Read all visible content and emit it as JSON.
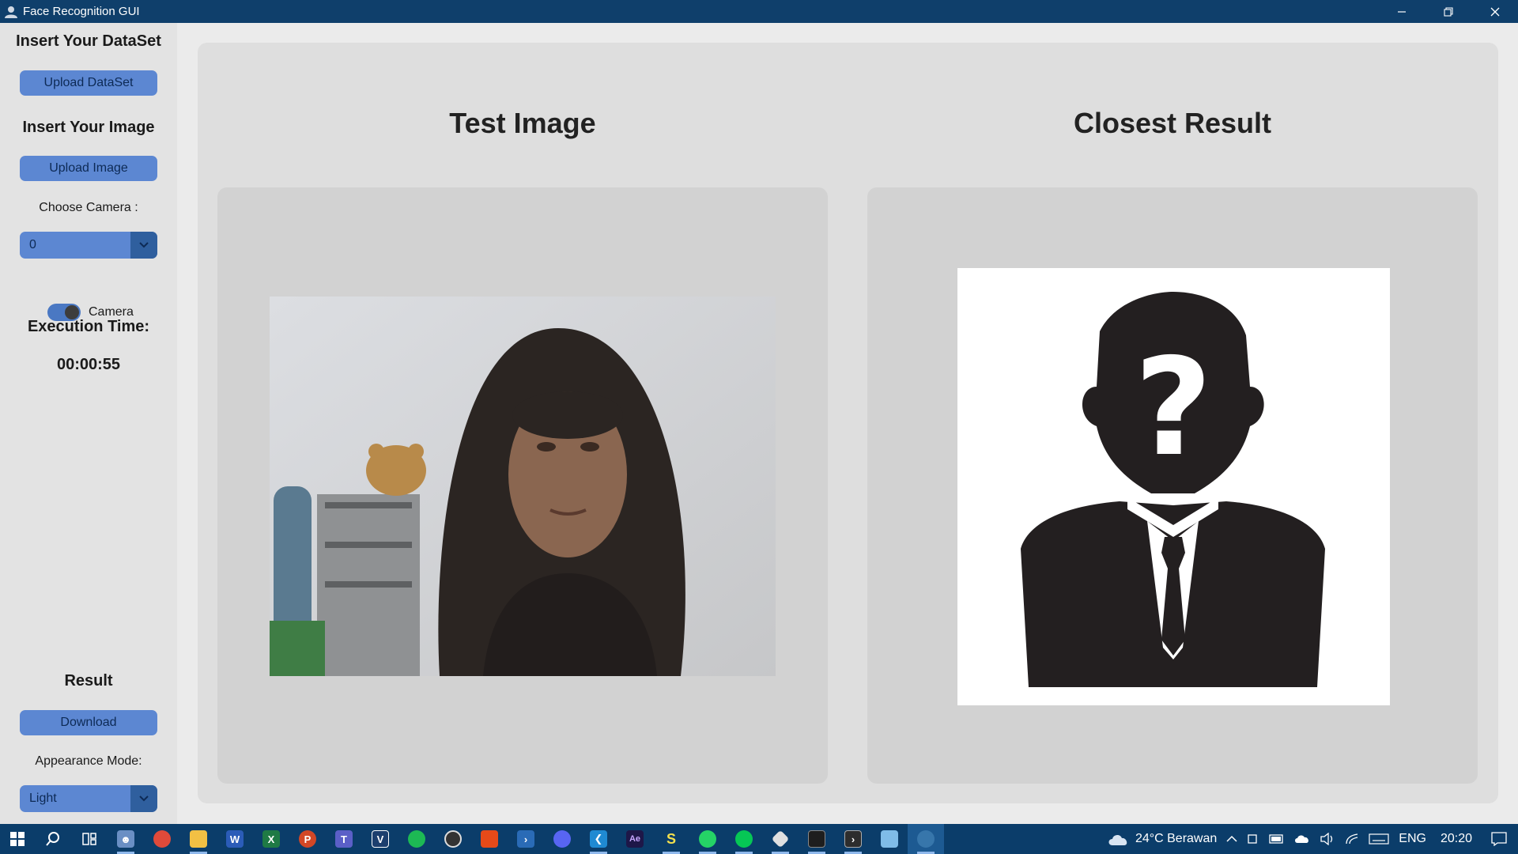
{
  "window": {
    "title": "Face Recognition GUI",
    "icon": "user-icon",
    "controls": [
      "minimize-icon",
      "restore-icon",
      "close-icon"
    ]
  },
  "sidebar": {
    "dataset_heading": "Insert Your DataSet",
    "upload_dataset_label": "Upload DataSet",
    "image_heading": "Insert Your Image",
    "upload_image_label": "Upload Image",
    "camera_label": "Choose Camera :",
    "camera_selected": "0",
    "camera_switch_label": "Camera",
    "camera_switch_on": true,
    "exec_time_heading": "Execution Time:",
    "exec_time_value": "00:00:55",
    "result_heading": "Result",
    "download_label": "Download",
    "appearance_label": "Appearance Mode:",
    "appearance_selected": "Light"
  },
  "main": {
    "test_title": "Test Image",
    "result_title": "Closest Result"
  },
  "taskbar": {
    "apps": [
      "windows-start-icon",
      "search-icon",
      "task-view-icon",
      "app-icon",
      "chrome-icon",
      "file-explorer-icon",
      "word-icon",
      "excel-icon",
      "powerpoint-icon",
      "teams-icon",
      "app-v-icon",
      "spotify-icon",
      "obs-icon",
      "office-icon",
      "powershell-icon",
      "discord-icon",
      "vscode-icon",
      "after-effects-icon",
      "app-s-icon",
      "whatsapp-icon",
      "line-icon",
      "git-icon",
      "terminal-icon",
      "terminal-2-icon",
      "notepad-icon",
      "python-icon"
    ],
    "weather": "24°C  Berawan",
    "lang": "ENG",
    "time": "20:20"
  },
  "colors": {
    "titlebar": "#0f3f6b",
    "button": "#5c87d2",
    "button_dark": "#2f5f9e",
    "taskbar": "#0b3d6a"
  }
}
